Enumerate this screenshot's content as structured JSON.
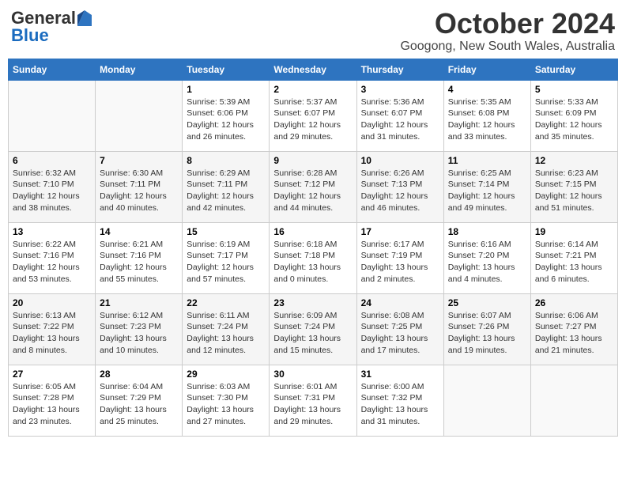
{
  "header": {
    "logo": {
      "general": "General",
      "blue": "Blue"
    },
    "title": "October 2024",
    "location": "Googong, New South Wales, Australia"
  },
  "days_of_week": [
    "Sunday",
    "Monday",
    "Tuesday",
    "Wednesday",
    "Thursday",
    "Friday",
    "Saturday"
  ],
  "weeks": [
    [
      {
        "day": "",
        "info": ""
      },
      {
        "day": "",
        "info": ""
      },
      {
        "day": "1",
        "info": "Sunrise: 5:39 AM\nSunset: 6:06 PM\nDaylight: 12 hours and 26 minutes."
      },
      {
        "day": "2",
        "info": "Sunrise: 5:37 AM\nSunset: 6:07 PM\nDaylight: 12 hours and 29 minutes."
      },
      {
        "day": "3",
        "info": "Sunrise: 5:36 AM\nSunset: 6:07 PM\nDaylight: 12 hours and 31 minutes."
      },
      {
        "day": "4",
        "info": "Sunrise: 5:35 AM\nSunset: 6:08 PM\nDaylight: 12 hours and 33 minutes."
      },
      {
        "day": "5",
        "info": "Sunrise: 5:33 AM\nSunset: 6:09 PM\nDaylight: 12 hours and 35 minutes."
      }
    ],
    [
      {
        "day": "6",
        "info": "Sunrise: 6:32 AM\nSunset: 7:10 PM\nDaylight: 12 hours and 38 minutes."
      },
      {
        "day": "7",
        "info": "Sunrise: 6:30 AM\nSunset: 7:11 PM\nDaylight: 12 hours and 40 minutes."
      },
      {
        "day": "8",
        "info": "Sunrise: 6:29 AM\nSunset: 7:11 PM\nDaylight: 12 hours and 42 minutes."
      },
      {
        "day": "9",
        "info": "Sunrise: 6:28 AM\nSunset: 7:12 PM\nDaylight: 12 hours and 44 minutes."
      },
      {
        "day": "10",
        "info": "Sunrise: 6:26 AM\nSunset: 7:13 PM\nDaylight: 12 hours and 46 minutes."
      },
      {
        "day": "11",
        "info": "Sunrise: 6:25 AM\nSunset: 7:14 PM\nDaylight: 12 hours and 49 minutes."
      },
      {
        "day": "12",
        "info": "Sunrise: 6:23 AM\nSunset: 7:15 PM\nDaylight: 12 hours and 51 minutes."
      }
    ],
    [
      {
        "day": "13",
        "info": "Sunrise: 6:22 AM\nSunset: 7:16 PM\nDaylight: 12 hours and 53 minutes."
      },
      {
        "day": "14",
        "info": "Sunrise: 6:21 AM\nSunset: 7:16 PM\nDaylight: 12 hours and 55 minutes."
      },
      {
        "day": "15",
        "info": "Sunrise: 6:19 AM\nSunset: 7:17 PM\nDaylight: 12 hours and 57 minutes."
      },
      {
        "day": "16",
        "info": "Sunrise: 6:18 AM\nSunset: 7:18 PM\nDaylight: 13 hours and 0 minutes."
      },
      {
        "day": "17",
        "info": "Sunrise: 6:17 AM\nSunset: 7:19 PM\nDaylight: 13 hours and 2 minutes."
      },
      {
        "day": "18",
        "info": "Sunrise: 6:16 AM\nSunset: 7:20 PM\nDaylight: 13 hours and 4 minutes."
      },
      {
        "day": "19",
        "info": "Sunrise: 6:14 AM\nSunset: 7:21 PM\nDaylight: 13 hours and 6 minutes."
      }
    ],
    [
      {
        "day": "20",
        "info": "Sunrise: 6:13 AM\nSunset: 7:22 PM\nDaylight: 13 hours and 8 minutes."
      },
      {
        "day": "21",
        "info": "Sunrise: 6:12 AM\nSunset: 7:23 PM\nDaylight: 13 hours and 10 minutes."
      },
      {
        "day": "22",
        "info": "Sunrise: 6:11 AM\nSunset: 7:24 PM\nDaylight: 13 hours and 12 minutes."
      },
      {
        "day": "23",
        "info": "Sunrise: 6:09 AM\nSunset: 7:24 PM\nDaylight: 13 hours and 15 minutes."
      },
      {
        "day": "24",
        "info": "Sunrise: 6:08 AM\nSunset: 7:25 PM\nDaylight: 13 hours and 17 minutes."
      },
      {
        "day": "25",
        "info": "Sunrise: 6:07 AM\nSunset: 7:26 PM\nDaylight: 13 hours and 19 minutes."
      },
      {
        "day": "26",
        "info": "Sunrise: 6:06 AM\nSunset: 7:27 PM\nDaylight: 13 hours and 21 minutes."
      }
    ],
    [
      {
        "day": "27",
        "info": "Sunrise: 6:05 AM\nSunset: 7:28 PM\nDaylight: 13 hours and 23 minutes."
      },
      {
        "day": "28",
        "info": "Sunrise: 6:04 AM\nSunset: 7:29 PM\nDaylight: 13 hours and 25 minutes."
      },
      {
        "day": "29",
        "info": "Sunrise: 6:03 AM\nSunset: 7:30 PM\nDaylight: 13 hours and 27 minutes."
      },
      {
        "day": "30",
        "info": "Sunrise: 6:01 AM\nSunset: 7:31 PM\nDaylight: 13 hours and 29 minutes."
      },
      {
        "day": "31",
        "info": "Sunrise: 6:00 AM\nSunset: 7:32 PM\nDaylight: 13 hours and 31 minutes."
      },
      {
        "day": "",
        "info": ""
      },
      {
        "day": "",
        "info": ""
      }
    ]
  ]
}
